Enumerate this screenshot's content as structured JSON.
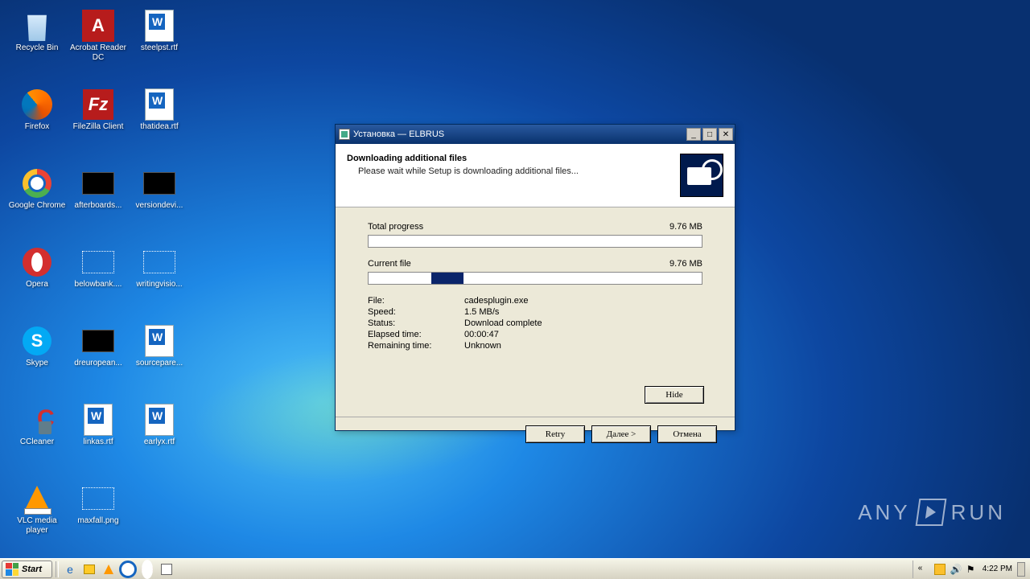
{
  "desktop": {
    "icons": [
      [
        {
          "label": "Recycle Bin",
          "kind": "bin"
        },
        {
          "label": "Acrobat Reader DC",
          "kind": "adobe"
        },
        {
          "label": "steelpst.rtf",
          "kind": "doc"
        }
      ],
      [
        {
          "label": "Firefox",
          "kind": "firefox"
        },
        {
          "label": "FileZilla Client",
          "kind": "filezilla"
        },
        {
          "label": "thatidea.rtf",
          "kind": "doc"
        }
      ],
      [
        {
          "label": "Google Chrome",
          "kind": "chrome"
        },
        {
          "label": "afterboards...",
          "kind": "black"
        },
        {
          "label": "versiondevi...",
          "kind": "black"
        }
      ],
      [
        {
          "label": "Opera",
          "kind": "opera"
        },
        {
          "label": "belowbank....",
          "kind": "empty"
        },
        {
          "label": "writingvisio...",
          "kind": "empty"
        }
      ],
      [
        {
          "label": "Skype",
          "kind": "skype"
        },
        {
          "label": "dreuropean...",
          "kind": "black"
        },
        {
          "label": "sourcepare...",
          "kind": "doc"
        }
      ],
      [
        {
          "label": "CCleaner",
          "kind": "ccleaner"
        },
        {
          "label": "linkas.rtf",
          "kind": "doc"
        },
        {
          "label": "earlyx.rtf",
          "kind": "doc"
        }
      ],
      [
        {
          "label": "VLC media player",
          "kind": "vlc"
        },
        {
          "label": "maxfall.png",
          "kind": "empty"
        }
      ]
    ]
  },
  "installer": {
    "title": "Установка — ELBRUS",
    "heading": "Downloading additional files",
    "subheading": "Please wait while Setup is downloading additional files...",
    "total": {
      "label": "Total progress",
      "value": "9.76 MB",
      "percent": 0
    },
    "current": {
      "label": "Current file",
      "value": "9.76 MB",
      "percent": 18
    },
    "details": {
      "file": {
        "k": "File:",
        "v": "cadesplugin.exe"
      },
      "speed": {
        "k": "Speed:",
        "v": "1.5 MB/s"
      },
      "status": {
        "k": "Status:",
        "v": "Download complete"
      },
      "elapsed": {
        "k": "Elapsed time:",
        "v": "00:00:47"
      },
      "remaining": {
        "k": "Remaining time:",
        "v": "Unknown"
      }
    },
    "buttons": {
      "hide": "Hide",
      "retry": "Retry",
      "next": "Далее >",
      "cancel": "Отмена"
    }
  },
  "taskbar": {
    "start": "Start",
    "clock": "4:22 PM"
  },
  "watermark": {
    "brand": "ANY",
    "brand2": "RUN"
  }
}
